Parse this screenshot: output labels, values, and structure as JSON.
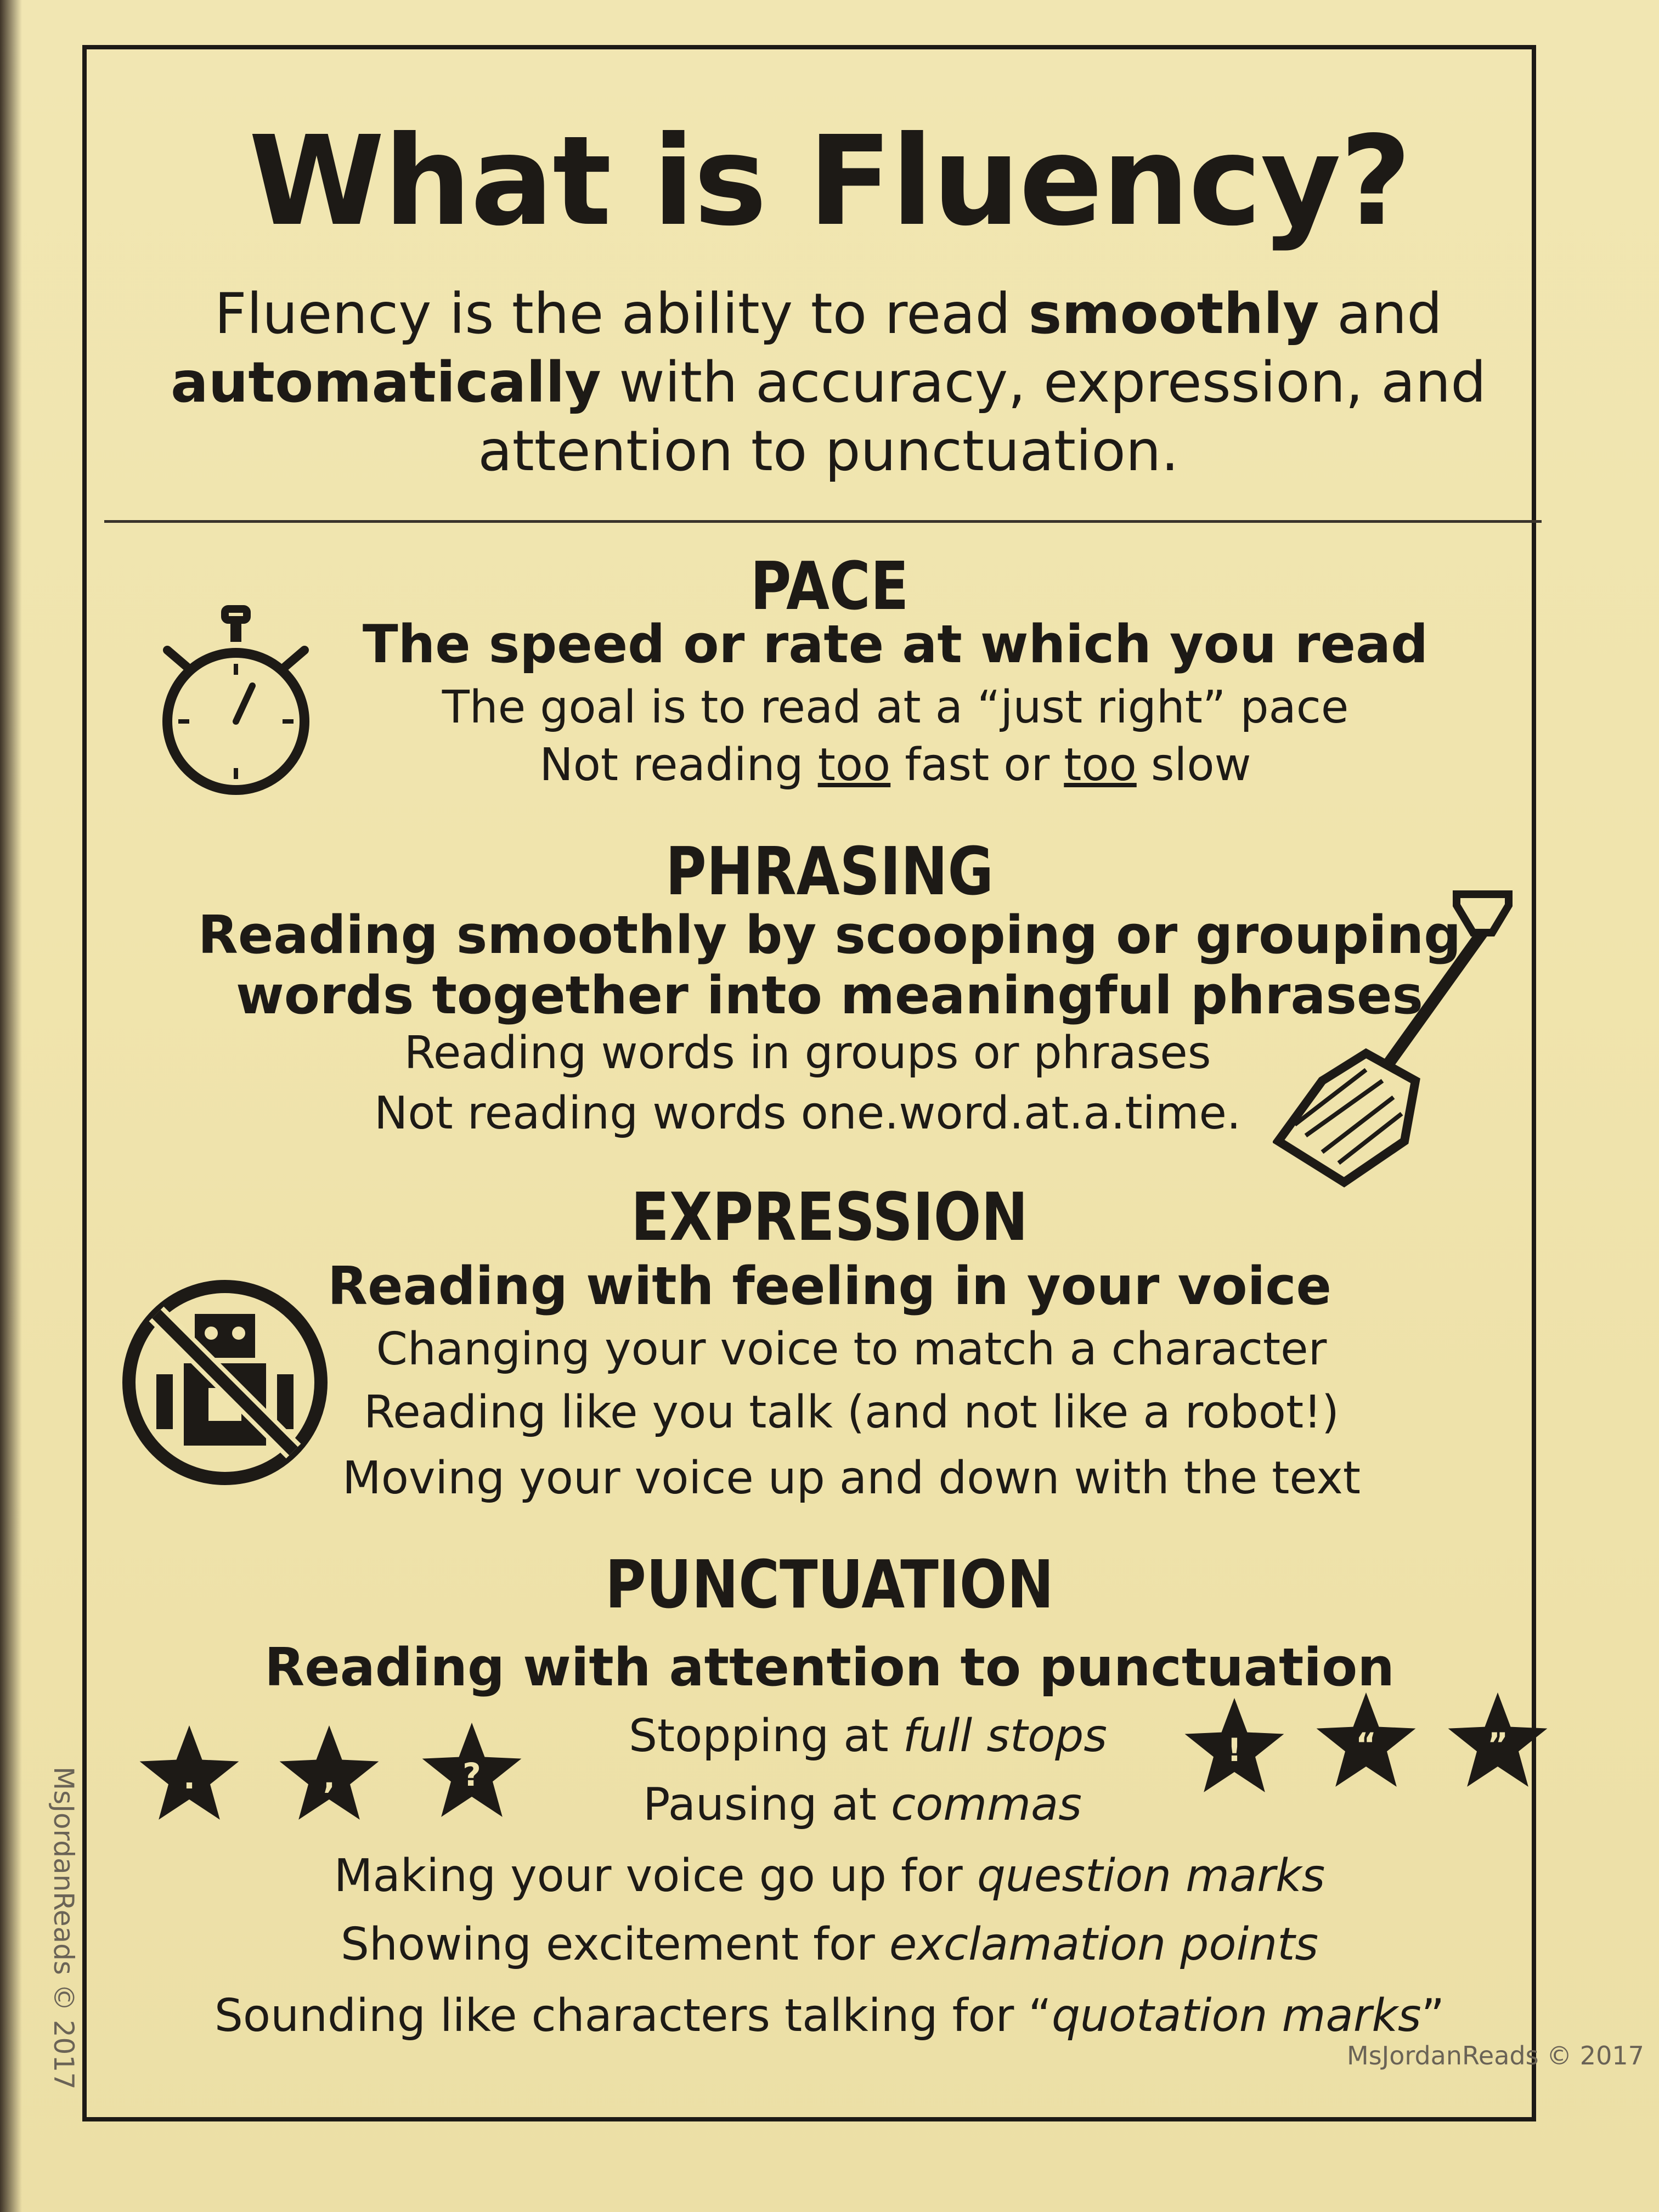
{
  "title": "What is Fluency?",
  "intro": {
    "p1": "Fluency is the ability to read ",
    "b1": "smoothly",
    "p2": " and ",
    "b2": "automatically",
    "p3": " with accuracy, expression, and attention to punctuation."
  },
  "pace": {
    "title": "PACE",
    "subtitle": "The speed or rate at which you read",
    "line1": "The goal is to read at a “just right” pace",
    "line2_a": "Not reading ",
    "line2_u1": "too",
    "line2_b": " fast or ",
    "line2_u2": "too",
    "line2_c": " slow"
  },
  "phrasing": {
    "title": "PHRASING",
    "subtitle1": "Reading smoothly by scooping or grouping",
    "subtitle2": "words together into meaningful phrases",
    "line1": "Reading words in groups or phrases",
    "line2": "Not reading words one.word.at.a.time."
  },
  "expression": {
    "title": "EXPRESSION",
    "subtitle": "Reading with feeling in your voice",
    "line1": "Changing your voice to match a character",
    "line2": "Reading like you talk (and not like a robot!)",
    "line3": "Moving your voice up and down with the text"
  },
  "punctuation": {
    "title": "PUNCTUATION",
    "subtitle": "Reading with attention to punctuation",
    "line1_a": "Stopping at ",
    "line1_i": "full stops",
    "line2_a": "Pausing at ",
    "line2_i": "commas",
    "line3_a": "Making your voice go up for ",
    "line3_i": "question marks",
    "line4_a": "Showing excitement for ",
    "line4_i": "exclamation points",
    "line5_a": "Sounding like characters talking for “",
    "line5_i": "quotation marks",
    "line5_b": "”",
    "stars": [
      ".",
      ",",
      "?",
      "!",
      "“",
      "”"
    ]
  },
  "credit_bottom": "MsJordanReads © 2017",
  "credit_side": "MsJordanReads © 2017",
  "colors": {
    "paper": "#f0e4ad",
    "ink": "#1d1a16"
  }
}
